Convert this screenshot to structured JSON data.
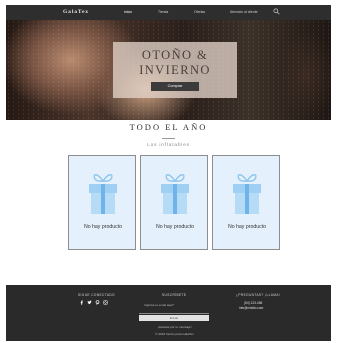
{
  "header": {
    "logo": "GalaTex",
    "nav": [
      "Inicio",
      "Tienda",
      "Ofertas",
      "Atención al cliente"
    ]
  },
  "hero": {
    "title_line1": "OTOÑO &",
    "title_line2": "INVIERNO",
    "button": "Comprar"
  },
  "section": {
    "title": "TODO EL AÑO",
    "subtitle": "Los inflatables"
  },
  "products": [
    {
      "label": "No hay producto"
    },
    {
      "label": "No hay producto"
    },
    {
      "label": "No hay producto"
    }
  ],
  "footer": {
    "social_heading": "SIGUE CONECTADO",
    "social_icons": [
      "facebook-icon",
      "twitter-icon",
      "pinterest-icon",
      "instagram-icon"
    ],
    "newsletter_heading": "SUSCRÍBETE",
    "email_label": "Ingresa tu email aquí*",
    "submit": "Enviar",
    "thanks": "¡Gracias por tu mensaje!",
    "copyright": "© 2023 hecho para GalaTex",
    "contact_heading": "¿PREGUNTAS? ¡LLAMA!",
    "phone": "(54) 123-456",
    "email": "info@misitio.com"
  },
  "colors": {
    "topbar": "#2e2e2e",
    "card_bg": "#e4f0fb",
    "gift_icon": "#8ec5ef",
    "footer": "#2a2a2a"
  }
}
